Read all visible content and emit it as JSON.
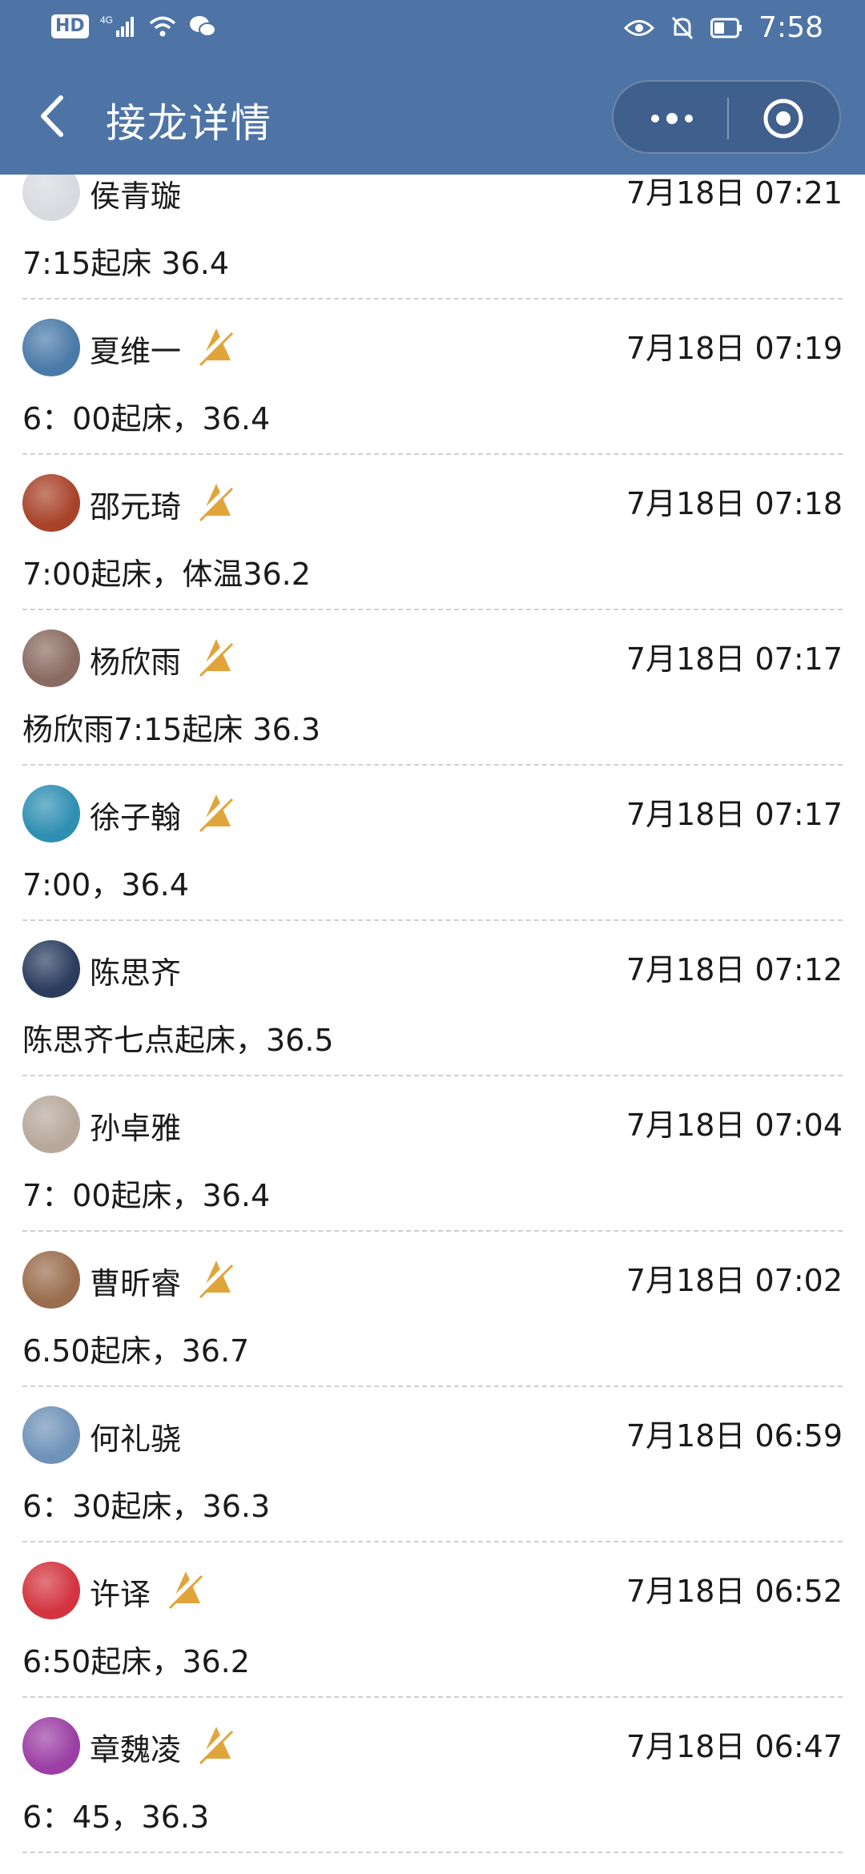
{
  "status_bar": {
    "network": "4G",
    "time": "7:58"
  },
  "header": {
    "title": "接龙详情"
  },
  "entries": [
    {
      "name": "侯青璇",
      "time": "7月18日 07:21",
      "message": "7:15起床 36.4",
      "muted": false,
      "avatar_color": "#d9dadf"
    },
    {
      "name": "夏维一",
      "time": "7月18日 07:19",
      "message": "6：00起床，36.4",
      "muted": true,
      "avatar_color": "#4a7aa8"
    },
    {
      "name": "邵元琦",
      "time": "7月18日 07:18",
      "message": "7:00起床，体温36.2",
      "muted": true,
      "avatar_color": "#a8432a"
    },
    {
      "name": "杨欣雨",
      "time": "7月18日 07:17",
      "message": "杨欣雨7:15起床 36.3",
      "muted": true,
      "avatar_color": "#8a6b62"
    },
    {
      "name": "徐子翰",
      "time": "7月18日 07:17",
      "message": "7:00，36.4",
      "muted": true,
      "avatar_color": "#2f8fb2"
    },
    {
      "name": "陈思齐",
      "time": "7月18日 07:12",
      "message": "陈思齐七点起床，36.5",
      "muted": false,
      "avatar_color": "#2b3c5e"
    },
    {
      "name": "孙卓雅",
      "time": "7月18日 07:04",
      "message": "7：00起床，36.4",
      "muted": false,
      "avatar_color": "#b7a89c"
    },
    {
      "name": "曹昕睿",
      "time": "7月18日 07:02",
      "message": "6.50起床，36.7",
      "muted": true,
      "avatar_color": "#9a6d4e"
    },
    {
      "name": "何礼骁",
      "time": "7月18日 06:59",
      "message": "6：30起床，36.3",
      "muted": false,
      "avatar_color": "#6f93b8"
    },
    {
      "name": "许译",
      "time": "7月18日 06:52",
      "message": "6:50起床，36.2",
      "muted": true,
      "avatar_color": "#d3343f"
    },
    {
      "name": "章魏凌",
      "time": "7月18日 06:47",
      "message": "6：45，36.3",
      "muted": true,
      "avatar_color": "#9b3fa4"
    }
  ],
  "colors": {
    "header_bg": "#4e74a6",
    "mute_icon": "#e0a53a",
    "divider": "#cfcfcf"
  }
}
